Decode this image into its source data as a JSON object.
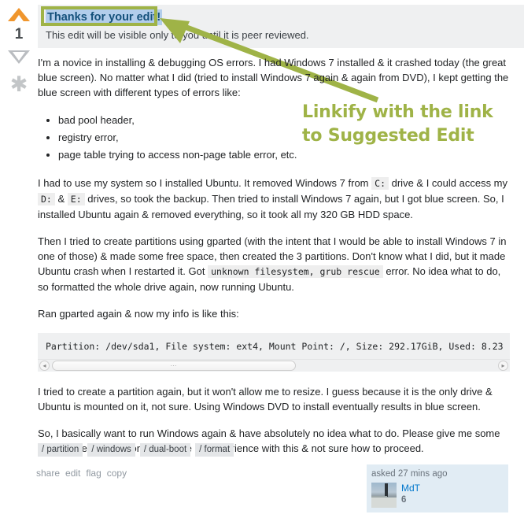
{
  "vote": {
    "up_icon": "vote-up-arrow-icon",
    "down_icon": "vote-down-arrow-icon",
    "count": "1",
    "favorite_icon": "favorite-star-icon",
    "up_color": "#f0962d",
    "down_color": "#babdc1",
    "star_color": "#c3c6c8"
  },
  "edit_banner": {
    "title": "Thanks for your edit!",
    "body": "This edit will be visible only to you until it is peer reviewed.",
    "background": "#eff0f1",
    "title_color": "#14507a",
    "selection_color": "#b2cdeb"
  },
  "annotation": {
    "caption_line1": "Linkify with the link",
    "caption_line2": "to Suggested Edit",
    "color": "#9fb347"
  },
  "post": {
    "paragraphs": {
      "p1": "I'm a novice in installing & debugging OS errors. I had Windows 7 installed & it crashed today (the great blue screen). No matter what I did (tried to install Windows 7 again & again from DVD), I kept getting the blue screen with different types of errors like:",
      "p2_a": "I had to use my system so I installed Ubuntu. It removed Windows 7 from",
      "p2_code1": "C:",
      "p2_b": "drive & I could access my",
      "p2_code2": "D:",
      "p2_amp": "&",
      "p2_code3": "E:",
      "p2_c": "drives, so took the backup. Then tried to install Windows 7 again, but I got blue screen. So, I installed Ubuntu again & removed everything, so it took all my 320 GB HDD space.",
      "p3_a": "Then I tried to create partitions using gparted (with the intent that I would be able to install Windows 7 in one of those) & made some free space, then created the 3 partitions. Don't know what I did, but it made Ubuntu crash when I restarted it. Got",
      "p3_code": "unknown filesystem, grub rescue",
      "p3_b": "error. No idea what to do, so formatted the whole drive again, now running Ubuntu.",
      "p4": "Ran gparted again & now my info is like this:",
      "p5": "I tried to create a partition again, but it won't allow me to resize. I guess because it is the only drive & Ubuntu is mounted on it, not sure. Using Windows DVD to install eventually results in blue screen.",
      "p6": "So, I basically want to run Windows again & have absolutely no idea what to do. Please give me some step by step instructions as I have no experience with this & not sure how to proceed."
    },
    "bullets": [
      "bad pool header,",
      "registry error,",
      "page table trying to access non-page table error, etc."
    ],
    "code_block": "Partition: /dev/sda1, File system: ext4, Mount Point: /, Size: 292.17GiB, Used: 8.23",
    "scrollbar": {
      "left_arrow": "◂",
      "right_arrow": "▸",
      "grip": "⋯"
    }
  },
  "tags": [
    "/ partition",
    "/ windows",
    "/ dual-boot",
    "/ format"
  ],
  "actions": [
    "share",
    "edit",
    "flag",
    "copy"
  ],
  "user_card": {
    "action_time": "asked 27 mins ago",
    "avatar_icon": "user-avatar-photo",
    "name": "MdT",
    "reputation": "6",
    "background": "#e1ecf4",
    "name_color": "#0077cc"
  }
}
